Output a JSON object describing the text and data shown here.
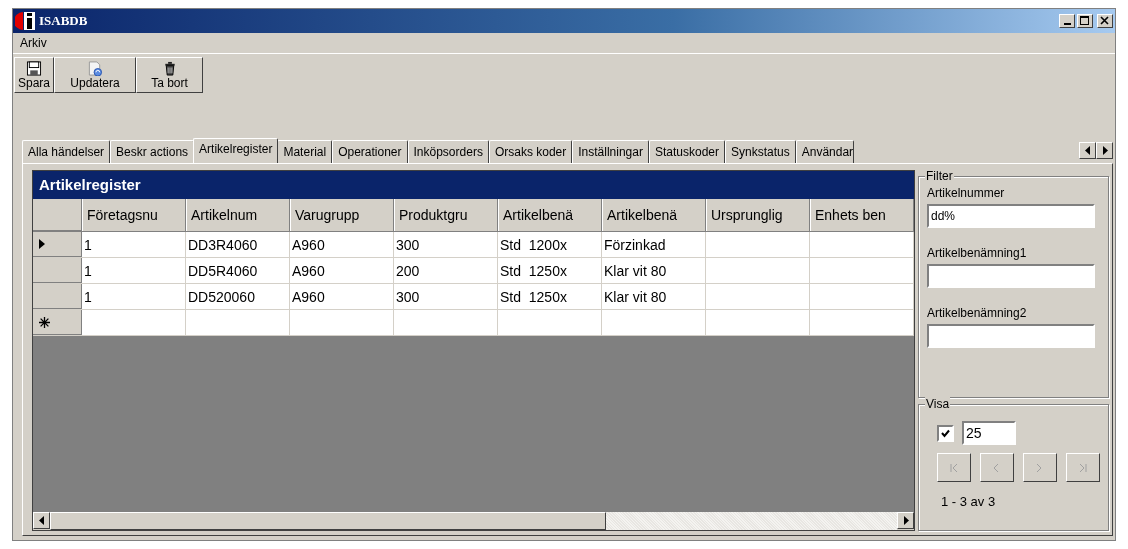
{
  "window": {
    "title": "ISABDB"
  },
  "menu": [
    "Arkiv"
  ],
  "toolbar": [
    {
      "kind": "save",
      "label": "Spara"
    },
    {
      "kind": "refresh",
      "label": "Updatera"
    },
    {
      "kind": "delete",
      "label": "Ta bort"
    }
  ],
  "tabs": [
    {
      "label": "Alla händelser",
      "selected": false
    },
    {
      "label": "Beskr actions",
      "selected": false
    },
    {
      "label": "Artikelregister",
      "selected": true
    },
    {
      "label": "Material",
      "selected": false
    },
    {
      "label": "Operationer",
      "selected": false
    },
    {
      "label": "Inköpsorders",
      "selected": false
    },
    {
      "label": "Orsaks koder",
      "selected": false
    },
    {
      "label": "Inställningar",
      "selected": false
    },
    {
      "label": "Statuskoder",
      "selected": false
    },
    {
      "label": "Synkstatus",
      "selected": false
    },
    {
      "label": "Användar",
      "selected": false
    }
  ],
  "grid": {
    "caption": "Artikelregister",
    "columns": [
      "Företagsnu",
      "Artikelnum",
      "Varugrupp",
      "Produktgru",
      "Artikelbenä",
      "Artikelbenä",
      "Ursprunglig",
      "Enhets ben"
    ],
    "rows": [
      {
        "current": true,
        "cells": [
          "1",
          "DD3R4060",
          "A960",
          "300",
          "Std  1200x",
          "Förzinkad",
          "",
          ""
        ]
      },
      {
        "current": false,
        "cells": [
          "1",
          "DD5R4060",
          "A960",
          "200",
          "Std  1250x",
          "Klar vit 80",
          "",
          ""
        ]
      },
      {
        "current": false,
        "cells": [
          "1",
          "DD520060",
          "A960",
          "300",
          "Std  1250x",
          "Klar vit 80",
          "",
          ""
        ]
      }
    ]
  },
  "filter": {
    "title": "Filter",
    "fields": [
      {
        "label": "Artikelnummer",
        "value": "dd%"
      },
      {
        "label": "Artikelbenämning1"
      },
      {
        "label": "Artikelbenämning2"
      }
    ]
  },
  "visa": {
    "title": "Visa",
    "checked": true,
    "count": "25",
    "nav": [
      {
        "kind": "first",
        "disabled": true
      },
      {
        "kind": "prev",
        "disabled": true
      },
      {
        "kind": "next",
        "disabled": true
      },
      {
        "kind": "last",
        "disabled": true
      }
    ],
    "summary": "1 - 3 av 3"
  }
}
